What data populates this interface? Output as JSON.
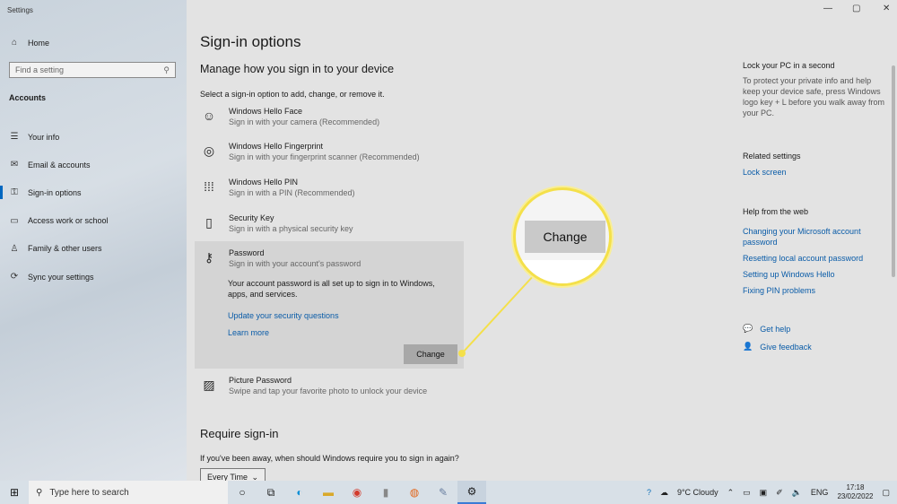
{
  "window": {
    "title": "Settings",
    "minimize_icon": "—",
    "maximize_icon": "▢",
    "close_icon": "✕"
  },
  "sidebar": {
    "home": "Home",
    "search_placeholder": "Find a setting",
    "section": "Accounts",
    "items": [
      {
        "label": "Your info",
        "icon": "user-info-icon"
      },
      {
        "label": "Email & accounts",
        "icon": "mail-icon"
      },
      {
        "label": "Sign-in options",
        "icon": "key-icon",
        "active": true
      },
      {
        "label": "Access work or school",
        "icon": "briefcase-icon"
      },
      {
        "label": "Family & other users",
        "icon": "person-add-icon"
      },
      {
        "label": "Sync your settings",
        "icon": "sync-icon"
      }
    ]
  },
  "main": {
    "title": "Sign-in options",
    "subtitle": "Manage how you sign in to your device",
    "intro": "Select a sign-in option to add, change, or remove it.",
    "options": [
      {
        "title": "Windows Hello Face",
        "desc": "Sign in with your camera (Recommended)"
      },
      {
        "title": "Windows Hello Fingerprint",
        "desc": "Sign in with your fingerprint scanner (Recommended)"
      },
      {
        "title": "Windows Hello PIN",
        "desc": "Sign in with a PIN (Recommended)"
      },
      {
        "title": "Security Key",
        "desc": "Sign in with a physical security key"
      },
      {
        "title": "Password",
        "desc": "Sign in with your account's password"
      },
      {
        "title": "Picture Password",
        "desc": "Swipe and tap your favorite photo to unlock your device"
      }
    ],
    "password_info": "Your account password is all set up to sign in to Windows, apps, and services.",
    "update_link": "Update your security questions",
    "learn_more": "Learn more",
    "change_button": "Change",
    "require_title": "Require sign-in",
    "require_question": "If you've been away, when should Windows require you to sign in again?",
    "require_value": "Every Time"
  },
  "right": {
    "lock_title": "Lock your PC in a second",
    "lock_body": "To protect your private info and help keep your device safe, press Windows logo key + L before you walk away from your PC.",
    "related_title": "Related settings",
    "lock_screen": "Lock screen",
    "web_title": "Help from the web",
    "web_links": [
      "Changing your Microsoft account password",
      "Resetting local account password",
      "Setting up Windows Hello",
      "Fixing PIN problems"
    ],
    "get_help": "Get help",
    "give_feedback": "Give feedback"
  },
  "callout": {
    "label": "Change",
    "color": "#f4e04a"
  },
  "taskbar": {
    "search_placeholder": "Type here to search",
    "weather": "9°C  Cloudy",
    "language": "ENG",
    "time": "17:18",
    "date": "23/02/2022"
  }
}
